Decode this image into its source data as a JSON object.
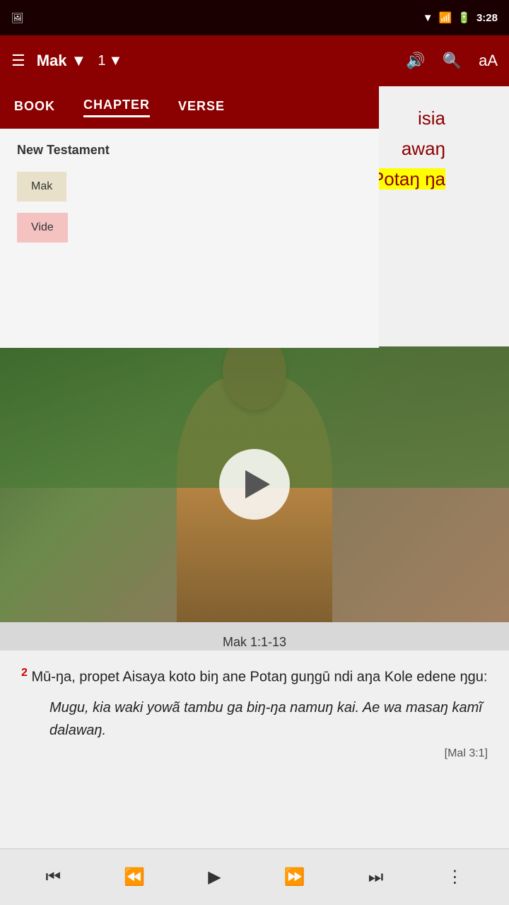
{
  "statusBar": {
    "time": "3:28",
    "icons": [
      "wifi",
      "signal-off",
      "battery"
    ]
  },
  "topBar": {
    "menuLabel": "☰",
    "bookLabel": "Mak",
    "bookDropdownIcon": "▼",
    "chapterLabel": "1",
    "chapterDropdownIcon": "▼",
    "volumeIcon": "🔊",
    "searchIcon": "🔍",
    "fontIcon": "aA"
  },
  "tabs": {
    "items": [
      {
        "label": "BOOK",
        "active": true
      },
      {
        "label": "CHAPTER",
        "active": false
      },
      {
        "label": "VERSE",
        "active": false
      }
    ]
  },
  "dropdown": {
    "sectionLabel": "New Testament",
    "books": [
      {
        "label": "Mak",
        "style": "selected"
      },
      {
        "label": "Vide",
        "style": "pink"
      }
    ]
  },
  "bgText": {
    "line1": "isia",
    "line2": "awaŋ",
    "line3": "Potaŋ ŋa"
  },
  "video": {
    "caption": "Mak 1:1-13"
  },
  "bibleText": {
    "verseNum": "2",
    "verseMain": "Mū-ŋa, propet Aisaya koto biŋ ane Potaŋ guŋgū ndi aŋa Kole edene ŋgu:",
    "verseItalic": "Mugu, kia waki yowã tambu ga biŋ-ŋa namuŋ kai. Ae wa masaŋ kamĩ dalawaŋ.",
    "footnote": "[Mal 3:1]"
  },
  "bottomBar": {
    "skipBackIcon": "⏮",
    "rewindIcon": "⏪",
    "playIcon": "▶",
    "fastForwardIcon": "⏩",
    "skipForwardIcon": "⏭",
    "menuIcon": "⋮"
  }
}
